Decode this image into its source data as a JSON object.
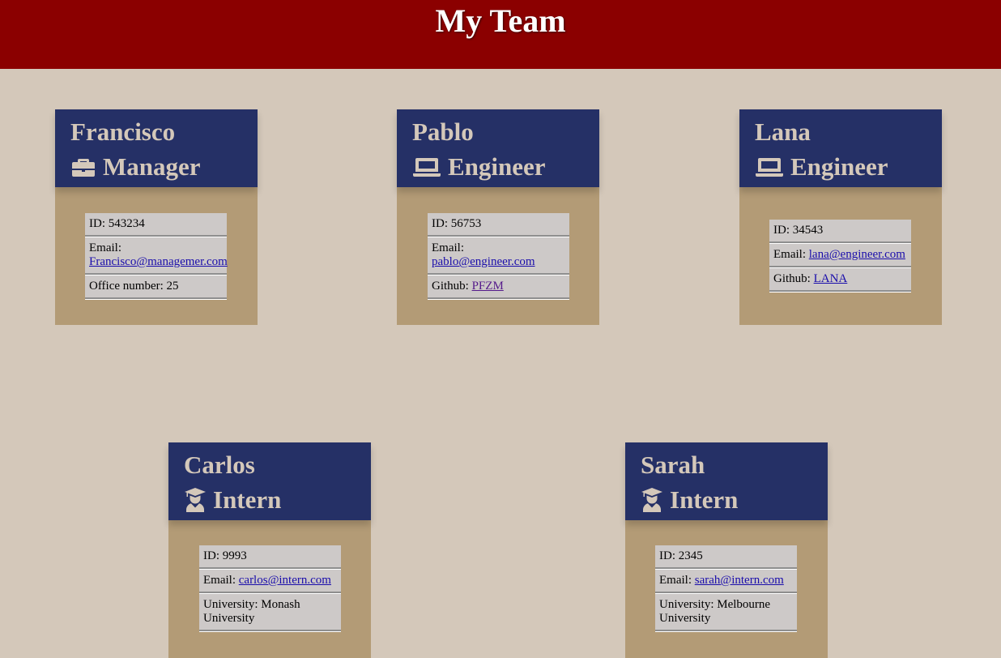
{
  "page": {
    "title": "My Team"
  },
  "employees": [
    {
      "name": "Francisco",
      "role": "Manager",
      "icon": "briefcase-icon",
      "id_label": "ID: 543234",
      "email_prefix": "Email:",
      "email": "Francisco@managemer.com",
      "extra_prefix": "Office number: 25",
      "extra_value": ""
    },
    {
      "name": "Pablo",
      "role": "Engineer",
      "icon": "laptop-icon",
      "id_label": "ID: 56753",
      "email_prefix": "Email:",
      "email": "pablo@engineer.com",
      "extra_prefix": "Github:",
      "extra_value": "PFZM"
    },
    {
      "name": "Lana",
      "role": "Engineer",
      "icon": "laptop-icon",
      "id_label": "ID: 34543",
      "email_prefix": "Email:",
      "email": "lana@engineer.com",
      "extra_prefix": "Github:",
      "extra_value": "LANA"
    },
    {
      "name": "Carlos",
      "role": "Intern",
      "icon": "graduate-icon",
      "id_label": "ID: 9993",
      "email_prefix": "Email:",
      "email": "carlos@intern.com",
      "extra_prefix": "University: Monash University",
      "extra_value": ""
    },
    {
      "name": "Sarah",
      "role": "Intern",
      "icon": "graduate-icon",
      "id_label": "ID: 2345",
      "email_prefix": "Email:",
      "email": "sarah@intern.com",
      "extra_prefix": "University: Melbourne University",
      "extra_value": ""
    }
  ]
}
